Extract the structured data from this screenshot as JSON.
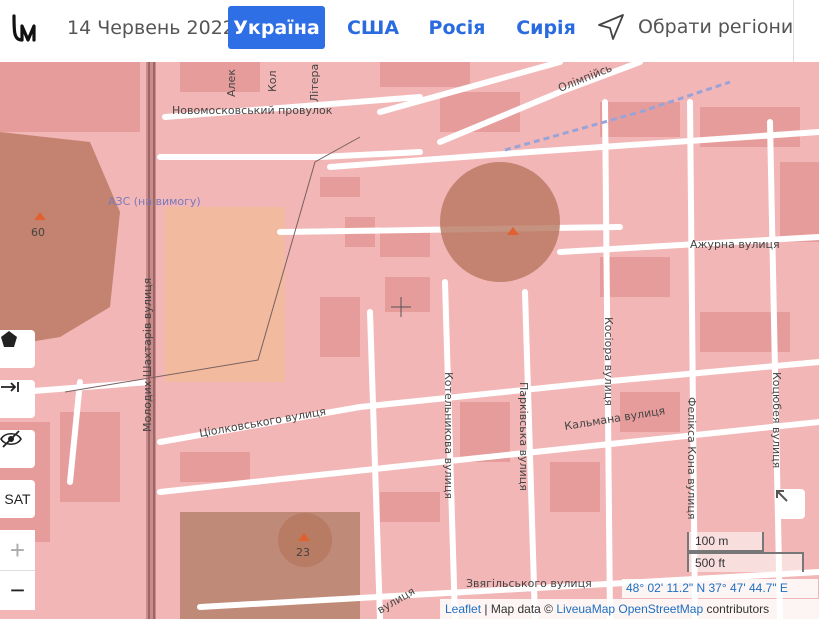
{
  "header": {
    "logo_text": "LM",
    "date": "14 Червень 2022",
    "tabs": [
      {
        "label": "Україна",
        "active": true
      },
      {
        "label": "США",
        "active": false
      },
      {
        "label": "Росія",
        "active": false
      },
      {
        "label": "Сирія",
        "active": false
      }
    ],
    "region_button": "Обрати регіони"
  },
  "map": {
    "streets": {
      "novomoskovskyi": "Новомосковський провулок",
      "olimpiiska": "Олімпійсь",
      "lit": "Літера",
      "kol": "Кол",
      "alek": "Алек",
      "azhurna": "Ажурна вулиця",
      "molodykh_shakhtariv": "Молодих Шахтарів вулиця",
      "tsiolkovskoho": "Ціолковського вулиця",
      "kotelnykova": "Котельникова вулиця",
      "parkivska": "Парківська вулиця",
      "kosiora": "Косіора вулиця",
      "kalmana": "Кальмана вулиця",
      "feliksa_kona": "Фелікса Кона вулиця",
      "kotsiubeia": "Коцюбея вулиця",
      "zviahilskoho": "Звягільського вулиця",
      "small_vul": "вулиця"
    },
    "poi_azs": "АЗС (на вимогу)",
    "markers": [
      {
        "label": "60"
      },
      {
        "label": "23"
      }
    ],
    "scale_m": "100 m",
    "scale_ft": "500 ft",
    "coordinates": "48° 02' 11.2\" N 37° 47' 44.7\" E",
    "attribution": {
      "leaflet": "Leaflet",
      "sep1": " | Map data © ",
      "liveuamap": "LiveuaMap",
      "space": " ",
      "osm": "OpenStreetMap",
      "tail": " contributors"
    }
  },
  "controls": {
    "polygon_icon": "pentagon-icon",
    "measure_icon": "arrow-right-bar-icon",
    "hide_icon": "eye-off-icon",
    "sat_label": "SAT",
    "zoom_in": "+",
    "zoom_out": "−",
    "expand_icon": "arrow-up-left-icon"
  },
  "colors": {
    "accent": "#2f6fe6",
    "map_overlay": "#f2b6b6",
    "circle_fill": "#b7775f"
  }
}
